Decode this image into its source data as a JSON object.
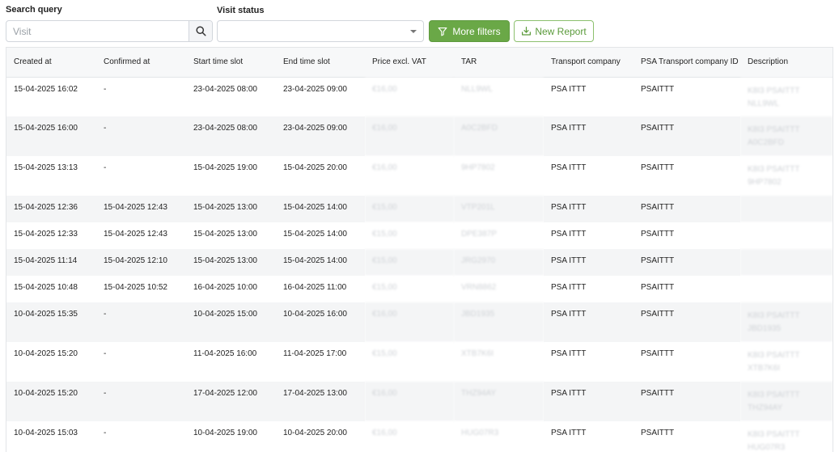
{
  "filters": {
    "search_label": "Search query",
    "search_placeholder": "Visit",
    "status_label": "Visit status",
    "status_value": "",
    "more_filters_label": "More filters",
    "new_report_label": "New Report",
    "accent_color": "#6aa847"
  },
  "table": {
    "columns": [
      "Created at",
      "Confirmed at",
      "Start time slot",
      "End time slot",
      "Price excl. VAT",
      "TAR",
      "Transport company",
      "PSA Transport company ID",
      "Description"
    ],
    "rows": [
      {
        "created": "15-04-2025 16:02",
        "confirmed": "-",
        "start": "23-04-2025 08:00",
        "end": "23-04-2025 09:00",
        "price": "€16,00",
        "tar": "NLL9WL",
        "company": "PSA ITTT",
        "company_id": "PSAITTT",
        "desc1": "K8I3 PSAITTT",
        "desc2": "NLL9WL"
      },
      {
        "created": "15-04-2025 16:00",
        "confirmed": "-",
        "start": "23-04-2025 08:00",
        "end": "23-04-2025 09:00",
        "price": "€16,00",
        "tar": "A0C2BFD",
        "company": "PSA ITTT",
        "company_id": "PSAITTT",
        "desc1": "K8I3 PSAITTT",
        "desc2": "A0C2BFD"
      },
      {
        "created": "15-04-2025 13:13",
        "confirmed": "-",
        "start": "15-04-2025 19:00",
        "end": "15-04-2025 20:00",
        "price": "€16,00",
        "tar": "9HP7802",
        "company": "PSA ITTT",
        "company_id": "PSAITTT",
        "desc1": "K8I3 PSAITTT",
        "desc2": "9HP7802"
      },
      {
        "created": "15-04-2025 12:36",
        "confirmed": "15-04-2025 12:43",
        "start": "15-04-2025 13:00",
        "end": "15-04-2025 14:00",
        "price": "€15,00",
        "tar": "VTP201L",
        "company": "PSA ITTT",
        "company_id": "PSAITTT",
        "desc1": "",
        "desc2": ""
      },
      {
        "created": "15-04-2025 12:33",
        "confirmed": "15-04-2025 12:43",
        "start": "15-04-2025 13:00",
        "end": "15-04-2025 14:00",
        "price": "€15,00",
        "tar": "DPE387P",
        "company": "PSA ITTT",
        "company_id": "PSAITTT",
        "desc1": "",
        "desc2": ""
      },
      {
        "created": "15-04-2025 11:14",
        "confirmed": "15-04-2025 12:10",
        "start": "15-04-2025 13:00",
        "end": "15-04-2025 14:00",
        "price": "€15,00",
        "tar": "JRG2970",
        "company": "PSA ITTT",
        "company_id": "PSAITTT",
        "desc1": "",
        "desc2": ""
      },
      {
        "created": "15-04-2025 10:48",
        "confirmed": "15-04-2025 10:52",
        "start": "16-04-2025 10:00",
        "end": "16-04-2025 11:00",
        "price": "€15,00",
        "tar": "VRN8862",
        "company": "PSA ITTT",
        "company_id": "PSAITTT",
        "desc1": "",
        "desc2": ""
      },
      {
        "created": "10-04-2025 15:35",
        "confirmed": "-",
        "start": "10-04-2025 15:00",
        "end": "10-04-2025 16:00",
        "price": "€16,00",
        "tar": "JBD1935",
        "company": "PSA ITTT",
        "company_id": "PSAITTT",
        "desc1": "K8I3 PSAITTT",
        "desc2": "JBD1935"
      },
      {
        "created": "10-04-2025 15:20",
        "confirmed": "-",
        "start": "11-04-2025 16:00",
        "end": "11-04-2025 17:00",
        "price": "€15,00",
        "tar": "XTB7K6I",
        "company": "PSA ITTT",
        "company_id": "PSAITTT",
        "desc1": "K8I3 PSAITTT",
        "desc2": "XTB7K6I"
      },
      {
        "created": "10-04-2025 15:20",
        "confirmed": "-",
        "start": "17-04-2025 12:00",
        "end": "17-04-2025 13:00",
        "price": "€16,00",
        "tar": "THZ94AY",
        "company": "PSA ITTT",
        "company_id": "PSAITTT",
        "desc1": "K8I3 PSAITTT",
        "desc2": "THZ94AY"
      },
      {
        "created": "10-04-2025 15:03",
        "confirmed": "-",
        "start": "10-04-2025 19:00",
        "end": "10-04-2025 20:00",
        "price": "€16,00",
        "tar": "HUG07R3",
        "company": "PSA ITTT",
        "company_id": "PSAITTT",
        "desc1": "K8I3 PSAITTT",
        "desc2": "HUG07R3"
      }
    ]
  }
}
